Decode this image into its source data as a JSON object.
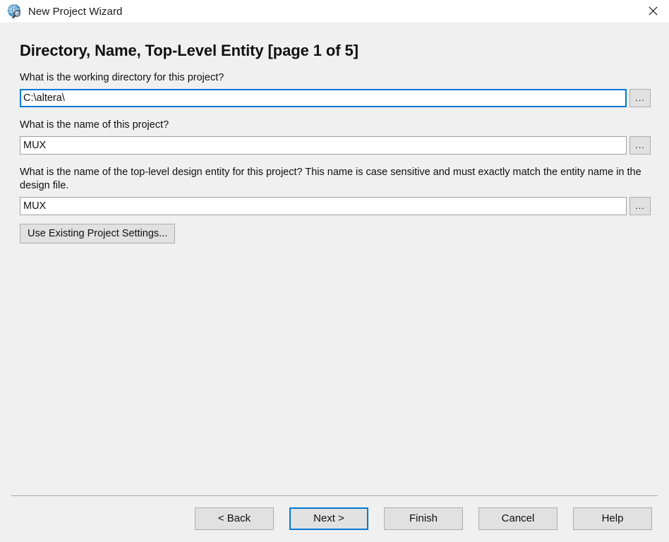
{
  "window": {
    "title": "New Project Wizard",
    "icon": "quartus-wizard-icon",
    "close_label": "✕",
    "accent_color": "#0078d7",
    "background_color": "#f0f0f0",
    "titlebar_color": "#ffffff"
  },
  "page": {
    "heading": "Directory, Name, Top-Level Entity [page 1 of 5]",
    "page_number": 1,
    "page_total": 5
  },
  "fields": [
    {
      "question": "What is the working directory for this project?",
      "value": "C:\\altera\\",
      "placeholder": "",
      "focused": true,
      "browse_label": "..."
    },
    {
      "question": "What is the name of this project?",
      "value": "MUX",
      "placeholder": "",
      "focused": false,
      "browse_label": "..."
    },
    {
      "question": "What is the name of the top-level design entity for this project? This name is case sensitive and must exactly match the entity name in the design file.",
      "value": "MUX",
      "placeholder": "",
      "focused": false,
      "browse_label": "..."
    }
  ],
  "existing_settings": {
    "label": "Use Existing Project Settings..."
  },
  "footer": {
    "buttons": [
      {
        "label": "< Back",
        "default": false
      },
      {
        "label": "Next >",
        "default": true
      },
      {
        "label": "Finish",
        "default": false
      },
      {
        "label": "Cancel",
        "default": false
      },
      {
        "label": "Help",
        "default": false
      }
    ]
  }
}
